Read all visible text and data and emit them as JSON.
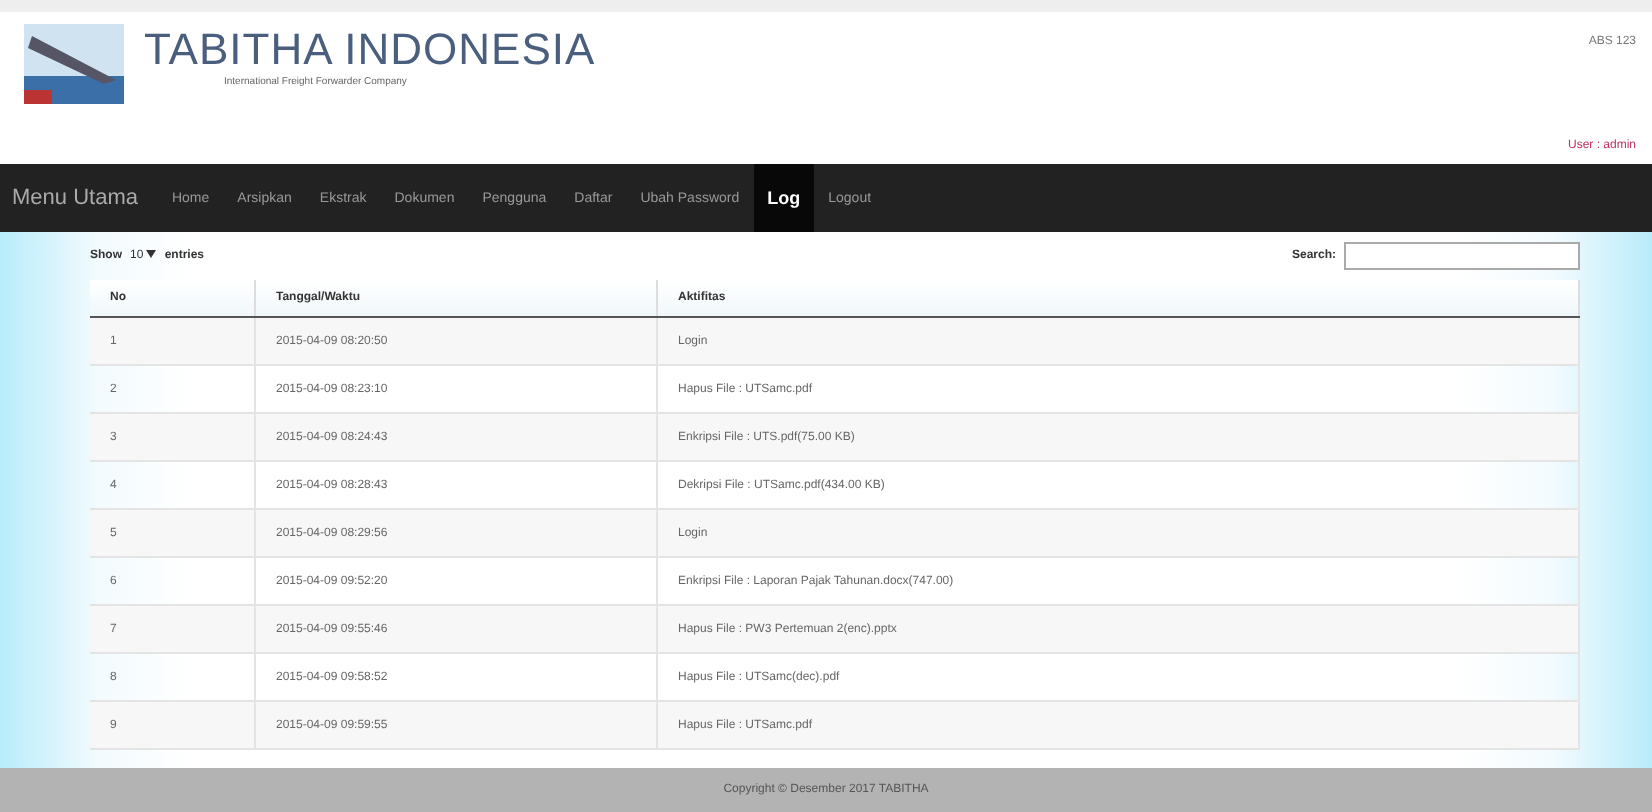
{
  "header": {
    "title": "TABITHA INDONESIA",
    "subtitle": "International Freight Forwarder Company",
    "top_right": "ABS 123",
    "user": "User : admin"
  },
  "nav": {
    "brand": "Menu Utama",
    "items": [
      {
        "label": "Home",
        "selected": false
      },
      {
        "label": "Arsipkan",
        "selected": false
      },
      {
        "label": "Ekstrak",
        "selected": false
      },
      {
        "label": "Dokumen",
        "selected": false
      },
      {
        "label": "Pengguna",
        "selected": false
      },
      {
        "label": "Daftar",
        "selected": false
      },
      {
        "label": "Ubah Password",
        "selected": false
      },
      {
        "label": "Log",
        "selected": true
      },
      {
        "label": "Logout",
        "selected": false
      }
    ]
  },
  "controls": {
    "show": "Show",
    "entries_value": "10",
    "entries": "entries",
    "search_label": "Search:"
  },
  "table": {
    "columns": [
      "No",
      "Tanggal/Waktu",
      "Aktifitas"
    ],
    "rows": [
      [
        "1",
        "2015-04-09 08:20:50",
        "Login"
      ],
      [
        "2",
        "2015-04-09 08:23:10",
        "Hapus File : UTSamc.pdf"
      ],
      [
        "3",
        "2015-04-09 08:24:43",
        "Enkripsi File : UTS.pdf(75.00 KB)"
      ],
      [
        "4",
        "2015-04-09 08:28:43",
        "Dekripsi File : UTSamc.pdf(434.00 KB)"
      ],
      [
        "5",
        "2015-04-09 08:29:56",
        "Login"
      ],
      [
        "6",
        "2015-04-09 09:52:20",
        "Enkripsi File : Laporan Pajak Tahunan.docx(747.00)"
      ],
      [
        "7",
        "2015-04-09 09:55:46",
        "Hapus File : PW3 Pertemuan 2(enc).pptx"
      ],
      [
        "8",
        "2015-04-09 09:58:52",
        "Hapus File : UTSamc(dec).pdf"
      ],
      [
        "9",
        "2015-04-09 09:59:55",
        "Hapus File : UTSamc.pdf"
      ]
    ]
  },
  "footer": "Copyright © Desember 2017 TABITHA"
}
